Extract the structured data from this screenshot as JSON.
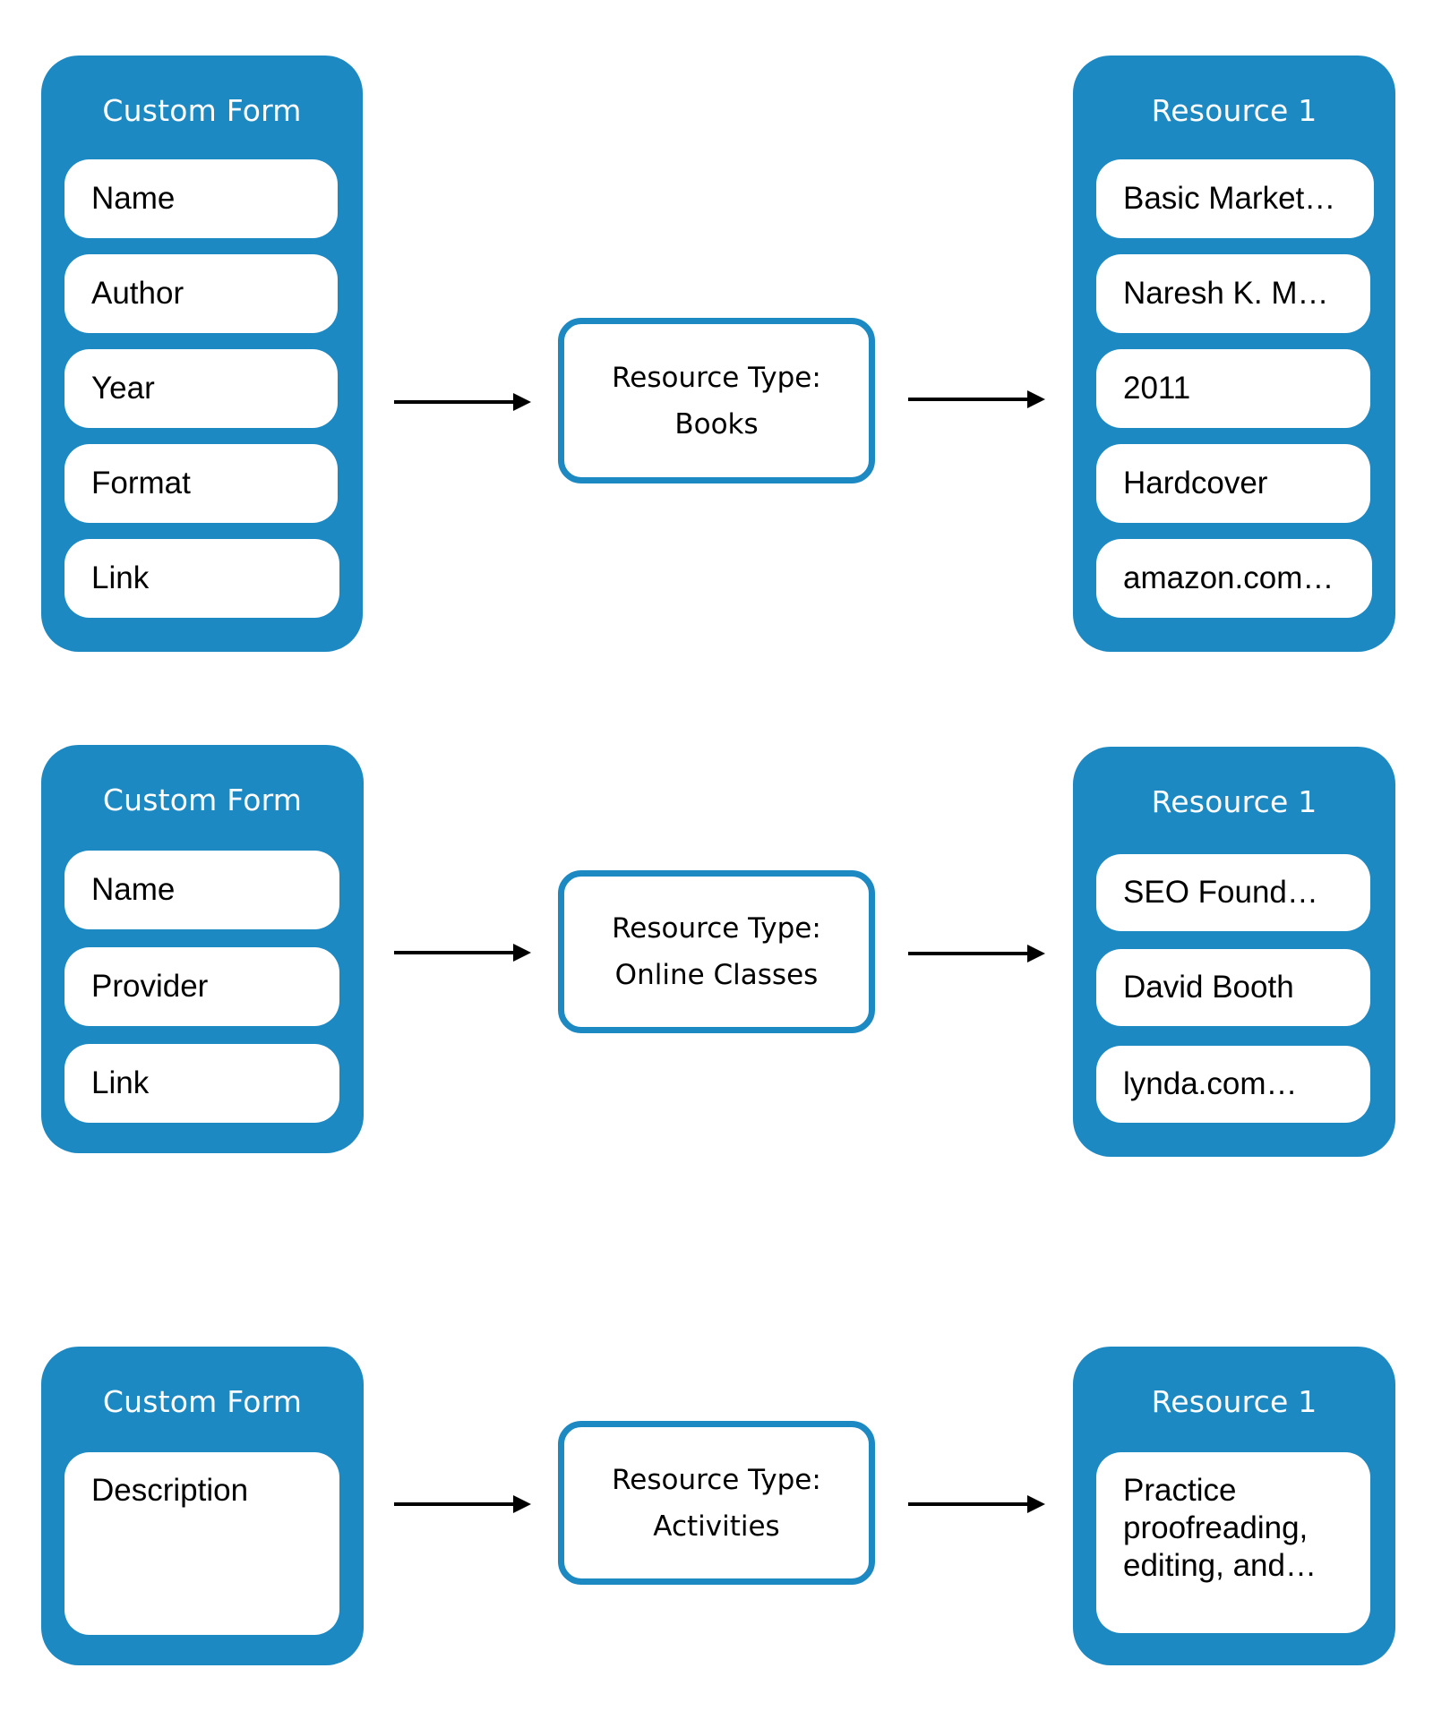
{
  "colors": {
    "accent": "#1d89c2",
    "background": "#ffffff",
    "arrow": "#000000"
  },
  "rows": [
    {
      "form": {
        "title": "Custom Form",
        "fields": [
          "Name",
          "Author",
          "Year",
          "Format",
          "Link"
        ]
      },
      "resource_type": {
        "line1": "Resource Type:",
        "line2": "Books"
      },
      "resource": {
        "title": "Resource 1",
        "values": [
          "Basic Market…",
          "Naresh K. M…",
          "2011",
          "Hardcover",
          "amazon.com…"
        ]
      }
    },
    {
      "form": {
        "title": "Custom Form",
        "fields": [
          "Name",
          "Provider",
          "Link"
        ]
      },
      "resource_type": {
        "line1": "Resource Type:",
        "line2": "Online Classes"
      },
      "resource": {
        "title": "Resource 1",
        "values": [
          "SEO Found…",
          "David Booth",
          "lynda.com…"
        ]
      }
    },
    {
      "form": {
        "title": "Custom Form",
        "fields": [
          "Description"
        ]
      },
      "resource_type": {
        "line1": "Resource Type:",
        "line2": "Activities"
      },
      "resource": {
        "title": "Resource 1",
        "values": [
          "Practice proofreading, editing, and…"
        ]
      }
    }
  ]
}
